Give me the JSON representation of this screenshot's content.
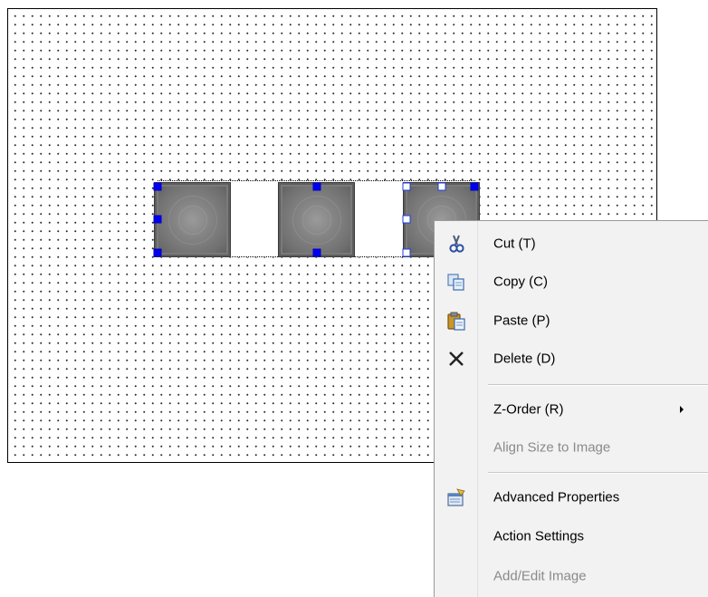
{
  "context_menu": {
    "items": [
      {
        "label": "Cut (T)",
        "icon": "scissors-icon",
        "enabled": true
      },
      {
        "label": "Copy (C)",
        "icon": "copy-icon",
        "enabled": true
      },
      {
        "label": "Paste (P)",
        "icon": "paste-icon",
        "enabled": true
      },
      {
        "label": "Delete (D)",
        "icon": "delete-x-icon",
        "enabled": true
      },
      {
        "label": "Z-Order (R)",
        "icon": null,
        "enabled": true,
        "submenu": true
      },
      {
        "label": "Align Size to Image",
        "icon": null,
        "enabled": false
      },
      {
        "label": "Advanced Properties",
        "icon": "properties-icon",
        "enabled": true
      },
      {
        "label": "Action Settings",
        "icon": null,
        "enabled": true
      },
      {
        "label": "Add/Edit Image",
        "icon": null,
        "enabled": false
      }
    ]
  },
  "colors": {
    "selection_handle": "#0000ee",
    "menu_background": "#f2f2f2",
    "disabled_text": "#8a8a8a"
  }
}
